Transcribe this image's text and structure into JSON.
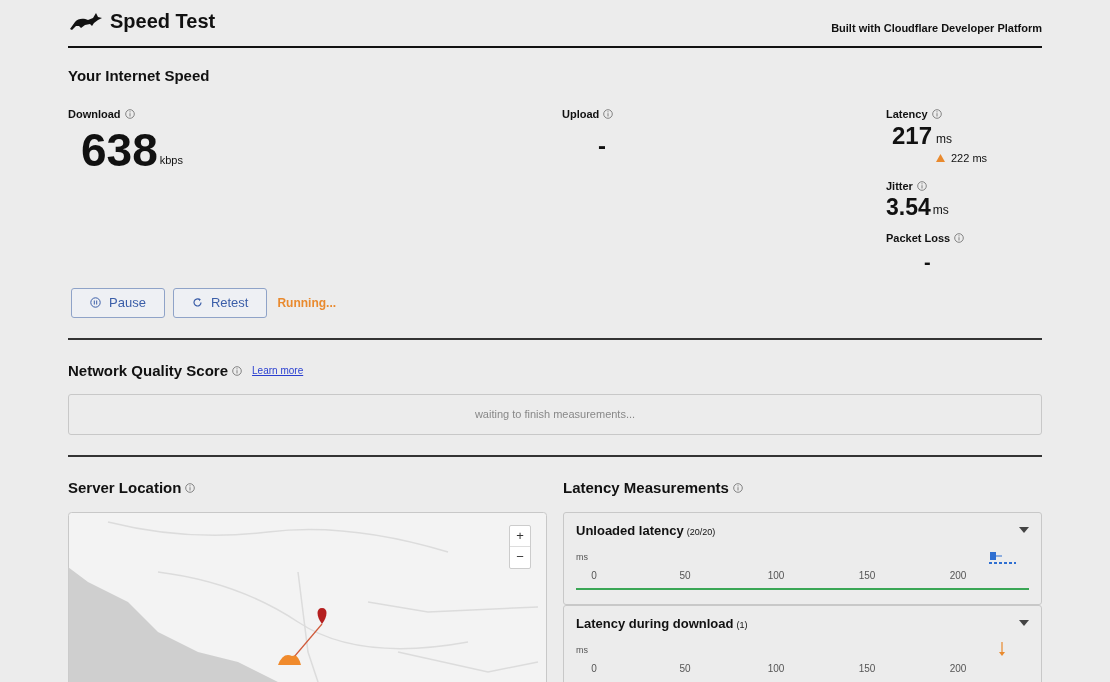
{
  "header": {
    "title": "Speed Test",
    "credit": "Built with Cloudflare Developer Platform"
  },
  "speed": {
    "heading": "Your Internet Speed",
    "download": {
      "label": "Download",
      "value": "638",
      "unit": "kbps"
    },
    "upload": {
      "label": "Upload",
      "value": "-"
    },
    "latency": {
      "label": "Latency",
      "value": "217",
      "unit": "ms",
      "loaded": "222 ms"
    },
    "jitter": {
      "label": "Jitter",
      "value": "3.54",
      "unit": "ms"
    },
    "packet_loss": {
      "label": "Packet Loss",
      "value": "-"
    },
    "buttons": [
      {
        "label": "Pause",
        "kind": "pause"
      },
      {
        "label": "Retest",
        "kind": "retest"
      }
    ],
    "status": "Running..."
  },
  "quality": {
    "heading": "Network Quality Score",
    "link": "Learn more",
    "message": "waiting to finish measurements..."
  },
  "server": {
    "heading": "Server Location",
    "map": {
      "zoom_in": "+",
      "zoom_out": "−"
    }
  },
  "latency_measurements": {
    "heading": "Latency Measurements",
    "panels": [
      {
        "title": "Unloaded latency",
        "count": "(20/20)",
        "unit": "ms",
        "ticks": [
          "0",
          "50",
          "100",
          "150",
          "200"
        ],
        "kind": "box",
        "baseline": true
      },
      {
        "title": "Latency during download",
        "count": "(1)",
        "unit": "ms",
        "ticks": [
          "0",
          "50",
          "100",
          "150",
          "200"
        ],
        "kind": "arrow",
        "baseline": false
      }
    ]
  }
}
